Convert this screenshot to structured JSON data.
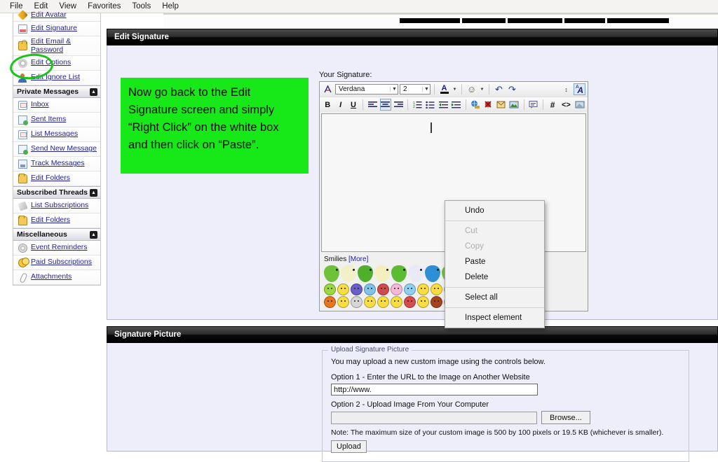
{
  "menubar": {
    "items": [
      "File",
      "Edit",
      "View",
      "Favorites",
      "Tools",
      "Help"
    ]
  },
  "topnav": {
    "redacted_bar_widths": [
      86,
      62,
      78,
      58,
      88
    ]
  },
  "sidebar": {
    "groups": [
      {
        "header": null,
        "items": [
          {
            "label": "Edit Avatar",
            "icon": "pencil-icon",
            "clipped": true
          },
          {
            "label": "Edit Signature",
            "icon": "document-icon"
          },
          {
            "label": "Edit Email & Password",
            "icon": "lock-icon",
            "two_line": true
          },
          {
            "label": "Edit Options",
            "icon": "gear-icon"
          },
          {
            "label": "Edit Ignore List",
            "icon": "user-icon"
          }
        ]
      },
      {
        "header": "Private Messages",
        "collapse": "▲",
        "items": [
          {
            "label": "Inbox",
            "icon": "inbox-icon"
          },
          {
            "label": "Sent Items",
            "icon": "mail-sent-icon"
          },
          {
            "label": "List Messages",
            "icon": "inbox-icon"
          },
          {
            "label": "Send New Message",
            "icon": "mail-new-icon"
          },
          {
            "label": "Track Messages",
            "icon": "mail-track-icon"
          },
          {
            "label": "Edit Folders",
            "icon": "folder-icon"
          }
        ]
      },
      {
        "header": "Subscribed Threads",
        "collapse": "▲",
        "items": [
          {
            "label": "List Subscriptions",
            "icon": "tag-icon"
          },
          {
            "label": "Edit Folders",
            "icon": "folder-icon"
          }
        ]
      },
      {
        "header": "Miscellaneous",
        "collapse": "▲",
        "items": [
          {
            "label": "Event Reminders",
            "icon": "cd-icon"
          },
          {
            "label": "Paid Subscriptions",
            "icon": "coins-icon"
          },
          {
            "label": "Attachments",
            "icon": "paperclip-icon"
          }
        ]
      }
    ]
  },
  "panels": {
    "edit_signature_title": "Edit Signature",
    "signature_picture_title": "Signature Picture"
  },
  "callout": {
    "text": "Now go back to the Edit Signature screen and simply “Right Click” on the white box and then click on “Paste”.",
    "background": "#17e817"
  },
  "editor": {
    "label": "Your Signature:",
    "font_family_value": "Verdana",
    "font_size_value": "2",
    "content": "",
    "toolbar_row1": [
      {
        "name": "style-picker-icon",
        "glyph": "✐"
      },
      {
        "name": "font-family-select",
        "value": "Verdana"
      },
      {
        "name": "font-size-select",
        "value": "2"
      },
      {
        "name": "font-color-icon",
        "glyph": "A"
      },
      {
        "name": "smiley-insert-icon",
        "glyph": "☺"
      },
      {
        "name": "undo-icon",
        "glyph": "↶"
      },
      {
        "name": "redo-icon",
        "glyph": "↷"
      },
      {
        "name": "line-height-icon",
        "glyph": "↕"
      },
      {
        "name": "toggle-wysiwyg-icon",
        "glyph": "A"
      }
    ],
    "toolbar_row2": [
      {
        "name": "bold-button",
        "glyph": "B"
      },
      {
        "name": "italic-button",
        "glyph": "I"
      },
      {
        "name": "underline-button",
        "glyph": "U"
      },
      {
        "name": "align-left-button",
        "glyph": "☰"
      },
      {
        "name": "align-center-button",
        "glyph": "☰",
        "selected": true
      },
      {
        "name": "align-right-button",
        "glyph": "☰"
      },
      {
        "name": "ordered-list-button",
        "glyph": "≡"
      },
      {
        "name": "unordered-list-button",
        "glyph": "≡"
      },
      {
        "name": "outdent-button",
        "glyph": "⇤"
      },
      {
        "name": "indent-button",
        "glyph": "⇥"
      },
      {
        "name": "insert-link-icon",
        "glyph": "●"
      },
      {
        "name": "remove-link-icon",
        "glyph": "✖"
      },
      {
        "name": "insert-email-icon",
        "glyph": "✉"
      },
      {
        "name": "insert-image-icon",
        "glyph": "⛰"
      },
      {
        "name": "insert-quote-icon",
        "glyph": "❝"
      },
      {
        "name": "insert-code-hash-icon",
        "glyph": "#"
      },
      {
        "name": "insert-html-icon",
        "glyph": "<>"
      },
      {
        "name": "insert-attachment-icon",
        "glyph": "◧"
      }
    ]
  },
  "smilies": {
    "label": "Smilies",
    "more_link": "[More]",
    "row1_birds": [
      "#6fc13a",
      "#f2f0c6",
      "#4fae2a",
      "#f5efc0",
      "#5bbb33",
      "#e8eaf5",
      "#2f8fd6",
      "#6fc13a",
      "#f0a93c",
      "#c9c9d4"
    ],
    "row2_faces": [
      "#9ad83e",
      "#f7dd3f",
      "#6a5fc7",
      "#7fc4e8",
      "#d14b4b",
      "#f6b8d8",
      "#8fd0f2",
      "#f7dd3f",
      "#f7dd3f",
      "#f7dd3f",
      "#f7dd3f",
      "#f7dd3f",
      "#f7dd3f",
      "#f7dd3f",
      "#f2c93c",
      "#f7dd3f"
    ],
    "row3_faces": [
      "#e8761f",
      "#f7dd3f",
      "#d6d6d6",
      "#f7dd3f",
      "#f7dd3f",
      "#f7dd3f",
      "#d94b4b",
      "#f7dd3f",
      "#a8431f",
      "#f7dd3f",
      "#f7dd3f",
      "#f7dd3f",
      "#3fae3f",
      "#f7dd3f",
      "#f0c98a"
    ]
  },
  "context_menu": {
    "items": [
      {
        "label": "Undo",
        "disabled": false
      },
      {
        "separator": true
      },
      {
        "label": "Cut",
        "disabled": true
      },
      {
        "label": "Copy",
        "disabled": true
      },
      {
        "label": "Paste",
        "disabled": false,
        "highlighted": true
      },
      {
        "label": "Delete",
        "disabled": false
      },
      {
        "separator": true
      },
      {
        "label": "Select all",
        "disabled": false
      },
      {
        "separator": true
      },
      {
        "label": "Inspect element",
        "disabled": false
      }
    ],
    "highlight_color": "#17c417"
  },
  "upload": {
    "legend": "Upload Signature Picture",
    "intro": "You may upload a new custom image using the controls below.",
    "option1_label": "Option 1 - Enter the URL to the Image on Another Website",
    "option1_value": "http://www.",
    "option2_label": "Option 2 - Upload Image From Your Computer",
    "browse_label": "Browse...",
    "file_value": "",
    "note": "Note: The maximum size of your custom image is 500 by 100 pixels or 19.5 KB (whichever is smaller).",
    "upload_label": "Upload"
  }
}
